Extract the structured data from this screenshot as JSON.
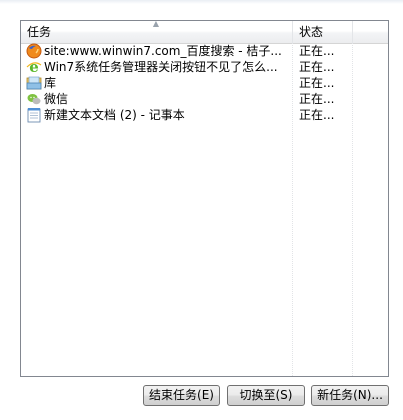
{
  "table": {
    "columns": {
      "task": "任务",
      "status": "状态"
    },
    "rows": [
      {
        "icon": "firefox-icon",
        "task": "site:www.winwin7.com_百度搜索 - 桔子...",
        "status": "正在..."
      },
      {
        "icon": "ie-icon",
        "task": "Win7系统任务管理器关闭按钮不见了怎么...",
        "status": "正在..."
      },
      {
        "icon": "library-folder-icon",
        "task": "库",
        "status": "正在..."
      },
      {
        "icon": "wechat-icon",
        "task": "微信",
        "status": "正在..."
      },
      {
        "icon": "notepad-icon",
        "task": "新建文本文档 (2) - 记事本",
        "status": "正在..."
      }
    ]
  },
  "buttons": {
    "end_task": "结束任务(E)",
    "switch_to": "切换至(S)",
    "new_task": "新任务(N)..."
  },
  "colors": {
    "border": "#828790",
    "button_border": "#707070",
    "firefox_orange": "#f08a1c",
    "ie_green": "#5cb82b"
  }
}
